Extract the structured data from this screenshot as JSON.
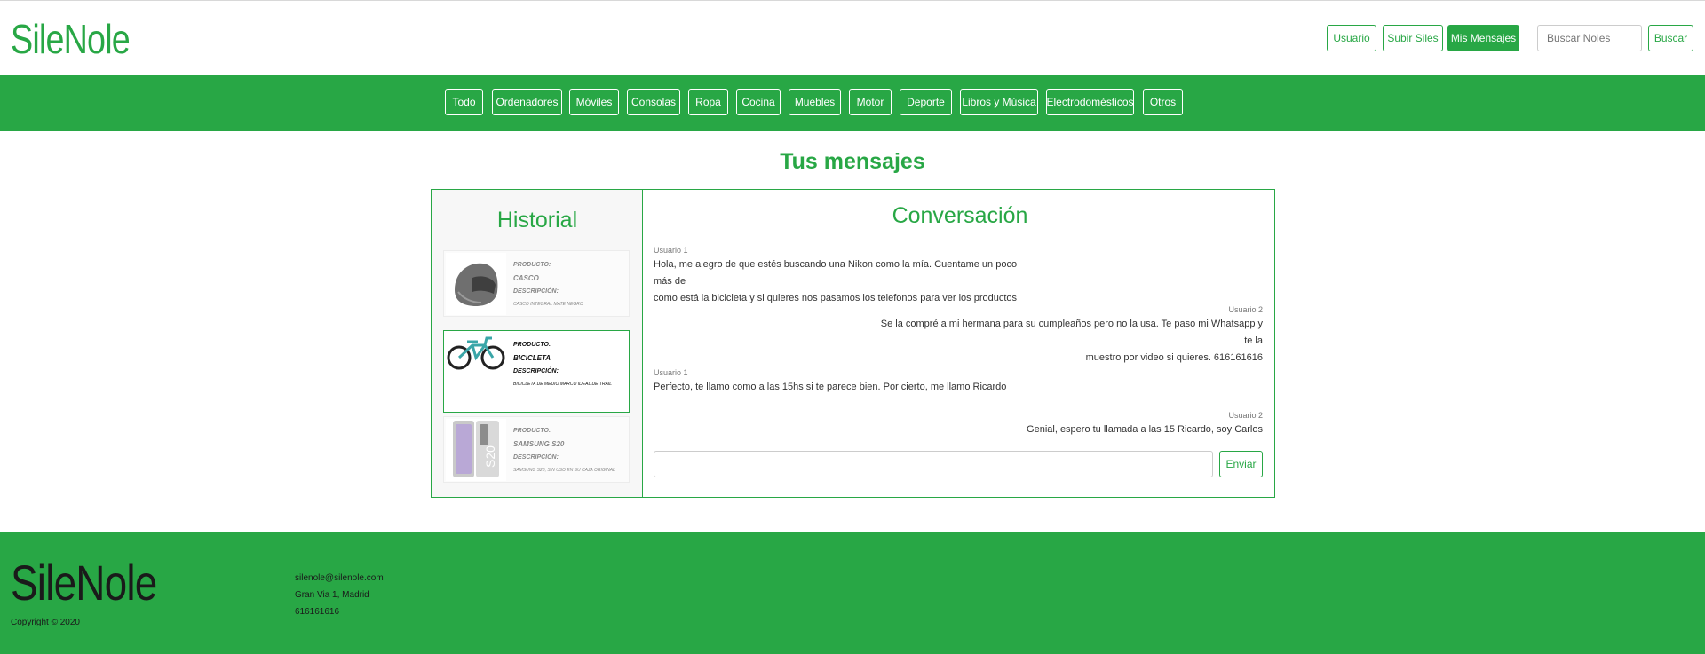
{
  "header": {
    "brand": "SileNole",
    "nav": {
      "user": "Usuario",
      "upload": "Subir Siles",
      "messages": "Mis Mensajes"
    },
    "search": {
      "placeholder": "Buscar Noles",
      "button": "Buscar"
    }
  },
  "categories": [
    "Todo",
    "Ordenadores",
    "Móviles",
    "Consolas",
    "Ropa",
    "Cocina",
    "Muebles",
    "Motor",
    "Deporte",
    "Libros y Música",
    "Electrodomésticos",
    "Otros"
  ],
  "main": {
    "title": "Tus mensajes",
    "history": {
      "title": "Historial",
      "items": [
        {
          "product_label": "PRODUCTO:",
          "product": "CASCO",
          "desc_label": "DESCRIPCIÓN:",
          "desc": "CASCO INTEGRAL MATE NEGRO",
          "thumb_icon": "helmet-icon",
          "active": false
        },
        {
          "product_label": "PRODUCTO:",
          "product": "BICICLETA",
          "desc_label": "DESCRIPCIÓN:",
          "desc": "BICICLETA DE MEDIO MARCO IDEAL DE TRAIL",
          "thumb_icon": "bicycle-icon",
          "active": true
        },
        {
          "product_label": "PRODUCTO:",
          "product": "SAMSUNG S20",
          "desc_label": "DESCRIPCIÓN:",
          "desc": "SAMSUNG S20, SIN USO EN SU CAJA ORIGINAL",
          "thumb_icon": "phone-icon",
          "active": false
        }
      ]
    },
    "conversation": {
      "title": "Conversación",
      "messages": [
        {
          "author": "Usuario 1",
          "line1": "Hola, me alegro de que estés buscando una Nikon como la mía. Cuentame un poco más de",
          "line2": "como está la bicicleta y si quieres nos pasamos los telefonos para ver los productos",
          "side": "left"
        },
        {
          "author": "Usuario 2",
          "line1": "Se la compré a mi hermana para su cumpleaños pero no la usa. Te paso mi Whatsapp y te la",
          "line2": "muestro por video si quieres. 616161616",
          "side": "right"
        },
        {
          "author": "Usuario 1",
          "line1": "Perfecto, te llamo como a las 15hs si te parece bien. Por cierto, me llamo Ricardo",
          "side": "left"
        },
        {
          "author": "Usuario 2",
          "line1": "Genial, espero tu llamada a las 15 Ricardo, soy Carlos",
          "side": "right"
        }
      ],
      "input_value": "",
      "send_label": "Enviar"
    }
  },
  "footer": {
    "brand": "SileNole",
    "copyright": "Copyright © 2020",
    "email": "silenole@silenole.com",
    "address": "Gran Via 1, Madrid",
    "phone": "616161616"
  },
  "colors": {
    "brand_green": "#28a745",
    "footer_text": "#1a1a1a"
  }
}
